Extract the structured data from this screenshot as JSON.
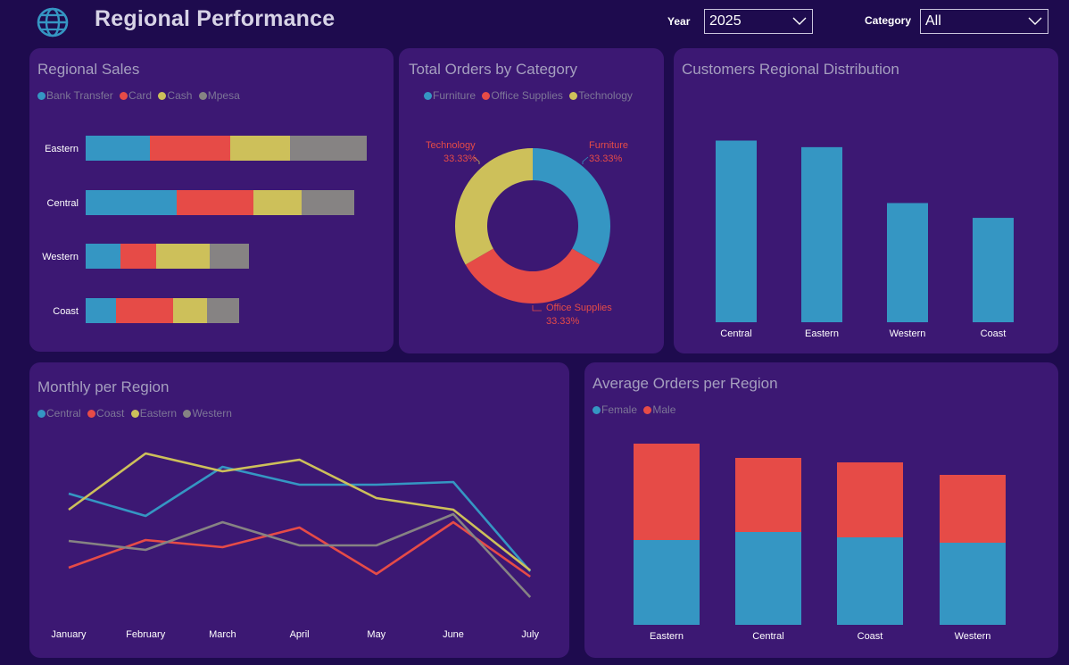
{
  "header": {
    "title": "Regional Performance",
    "year_label": "Year",
    "year_value": "2025",
    "category_label": "Category",
    "category_value": "All"
  },
  "colors": {
    "background": "#1e0b4e",
    "card": "#3c1873",
    "blue": "#3596c3",
    "red": "#e64b47",
    "yellow": "#cdc05a",
    "gray": "#868383"
  },
  "regional_sales": {
    "title": "Regional Sales",
    "legend": [
      "Bank Transfer",
      "Card",
      "Cash",
      "Mpesa"
    ]
  },
  "orders_by_category": {
    "title": "Total Orders by Category",
    "legend": [
      "Furniture",
      "Office Supplies",
      "Technology"
    ],
    "labels": [
      {
        "name": "Technology",
        "pct": "33.33%"
      },
      {
        "name": "Furniture",
        "pct": "33.33%"
      },
      {
        "name": "Office Supplies",
        "pct": "33.33%"
      }
    ]
  },
  "customers_distribution": {
    "title": "Customers Regional Distribution"
  },
  "monthly_per_region": {
    "title": "Monthly per Region",
    "legend": [
      "Central",
      "Coast",
      "Eastern",
      "Western"
    ]
  },
  "average_orders": {
    "title": "Average Orders per Region",
    "legend": [
      "Female",
      "Male"
    ]
  },
  "chart_data": [
    {
      "type": "bar",
      "orientation": "horizontal",
      "stacked": true,
      "title": "Regional Sales",
      "categories": [
        "Eastern",
        "Central",
        "Western",
        "Coast"
      ],
      "series": [
        {
          "name": "Bank Transfer",
          "color": "#3596c3",
          "values": [
            72,
            102,
            39,
            34
          ]
        },
        {
          "name": "Card",
          "color": "#e64b47",
          "values": [
            90,
            86,
            40,
            64
          ]
        },
        {
          "name": "Cash",
          "color": "#cdc05a",
          "values": [
            67,
            54,
            60,
            38
          ]
        },
        {
          "name": "Mpesa",
          "color": "#868383",
          "values": [
            86,
            59,
            44,
            36
          ]
        }
      ],
      "grid": false,
      "legend": "top-left"
    },
    {
      "type": "pie",
      "donut": true,
      "title": "Total Orders by Category",
      "categories": [
        "Furniture",
        "Office Supplies",
        "Technology"
      ],
      "values": [
        33.33,
        33.33,
        33.33
      ],
      "colors": [
        "#3596c3",
        "#e64b47",
        "#cdc05a"
      ],
      "legend": "top-left"
    },
    {
      "type": "bar",
      "title": "Customers Regional Distribution",
      "categories": [
        "Central",
        "Eastern",
        "Western",
        "Coast"
      ],
      "values": [
        221,
        213,
        145,
        127
      ],
      "color": "#3596c3",
      "ylim": [
        0,
        240
      ],
      "grid": false
    },
    {
      "type": "line",
      "title": "Monthly per Region",
      "categories": [
        "January",
        "February",
        "March",
        "April",
        "May",
        "June",
        "July"
      ],
      "series": [
        {
          "name": "Central",
          "color": "#3596c3",
          "values": [
            150,
            125,
            180,
            160,
            160,
            163,
            63
          ]
        },
        {
          "name": "Coast",
          "color": "#e64b47",
          "values": [
            67,
            98,
            90,
            112,
            60,
            118,
            57
          ]
        },
        {
          "name": "Eastern",
          "color": "#cdc05a",
          "values": [
            132,
            195,
            175,
            188,
            145,
            132,
            64
          ]
        },
        {
          "name": "Western",
          "color": "#868383",
          "values": [
            97,
            87,
            118,
            92,
            92,
            127,
            34
          ]
        }
      ],
      "ylim": [
        0,
        220
      ],
      "grid": false,
      "legend": "top-left"
    },
    {
      "type": "bar",
      "stacked": true,
      "title": "Average Orders per Region",
      "categories": [
        "Eastern",
        "Central",
        "Coast",
        "Western"
      ],
      "series": [
        {
          "name": "Female",
          "color": "#3596c3",
          "values": [
            95,
            104,
            98,
            92
          ]
        },
        {
          "name": "Male",
          "color": "#e64b47",
          "values": [
            108,
            83,
            84,
            76
          ]
        }
      ],
      "ylim": [
        0,
        220
      ],
      "grid": false,
      "legend": "top-left"
    }
  ]
}
